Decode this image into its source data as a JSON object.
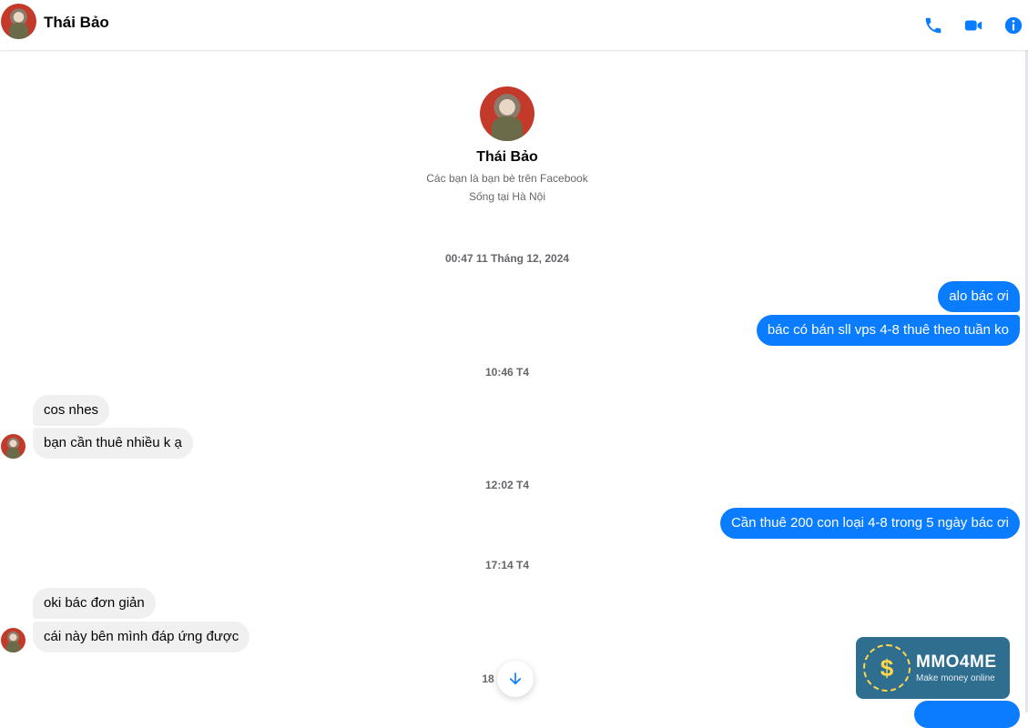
{
  "header": {
    "name": "Thái Bảo",
    "icons": [
      "phone-icon",
      "video-camera-icon",
      "info-icon"
    ]
  },
  "profile": {
    "name": "Thái Bảo",
    "line1": "Các bạn là bạn bè trên Facebook",
    "line2": "Sống tại Hà Nội"
  },
  "timestamps": [
    "00:47 11 Tháng 12, 2024",
    "10:46 T4",
    "12:02 T4",
    "17:14 T4",
    "18"
  ],
  "messages": [
    {
      "side": "out",
      "text": "alo bác ơi"
    },
    {
      "side": "out",
      "text": "bác có bán sll vps 4-8 thuê theo tuần ko"
    },
    {
      "side": "in",
      "text": "cos nhes"
    },
    {
      "side": "in",
      "text": "bạn cần thuê nhiều k ạ"
    },
    {
      "side": "out",
      "text": "Cần thuê 200 con loại 4-8 trong 5 ngày bác ơi"
    },
    {
      "side": "in",
      "text": "oki bác đơn giản"
    },
    {
      "side": "in",
      "text": "cái này bên mình đáp ứng được"
    }
  ],
  "watermark": {
    "brand": "MMO4ME",
    "tagline": "Make money online",
    "symbol": "$"
  },
  "colors": {
    "accent": "#0a7cff",
    "incoming_bg": "#f0f0f0",
    "muted_text": "#65676b"
  }
}
